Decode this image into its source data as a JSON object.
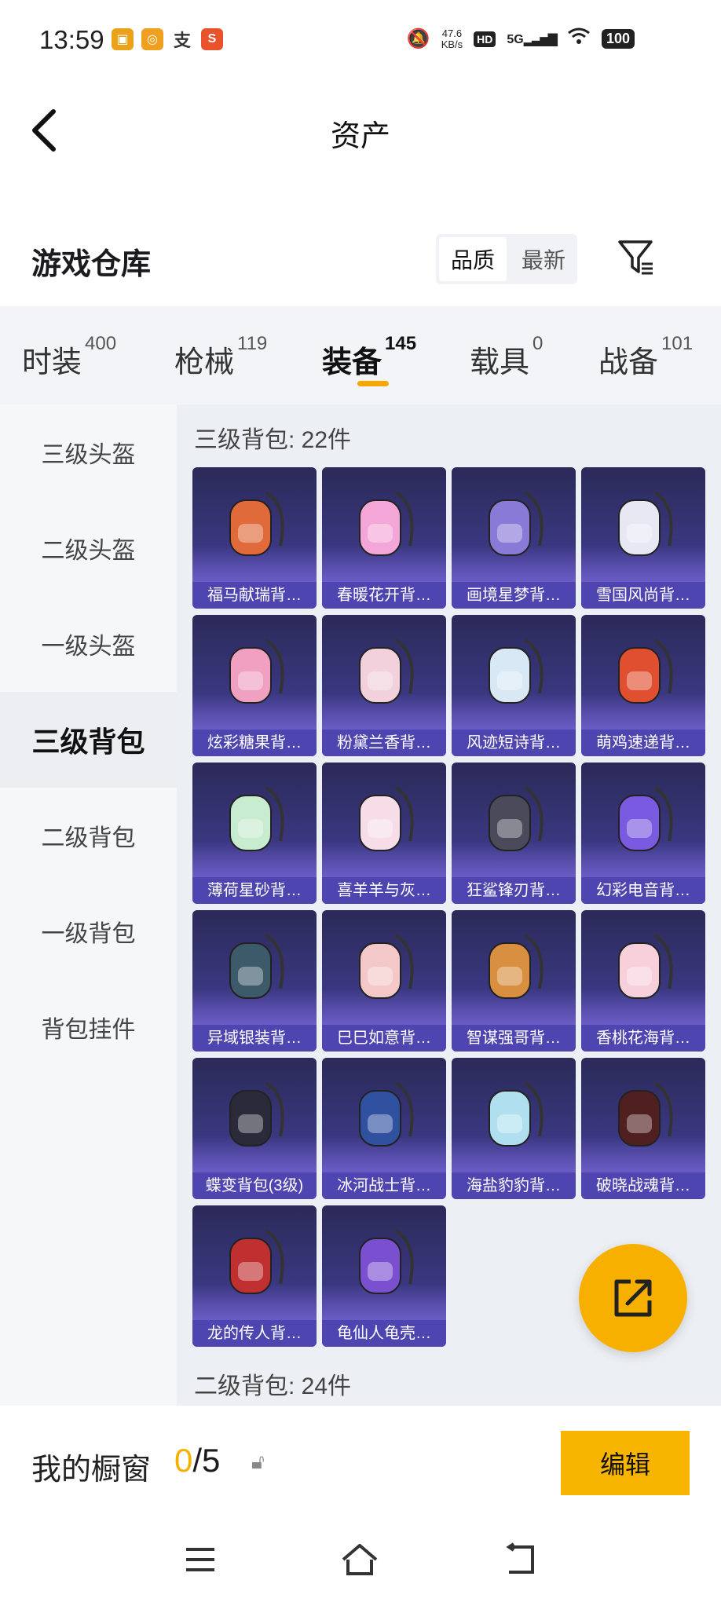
{
  "status": {
    "time": "13:59",
    "net_speed": "47.6",
    "net_unit": "KB/s",
    "hd": "HD",
    "signal": "5G",
    "battery": "100",
    "app_icons": [
      "app-icon-1",
      "app-icon-2",
      "alipay-icon",
      "app-icon-4"
    ]
  },
  "header": {
    "title": "资产"
  },
  "warehouse": {
    "title": "游戏仓库",
    "sort_options": [
      "品质",
      "最新"
    ],
    "active_sort": "品质"
  },
  "categories": [
    {
      "label": "时装",
      "count": "400"
    },
    {
      "label": "枪械",
      "count": "119"
    },
    {
      "label": "装备",
      "count": "145"
    },
    {
      "label": "载具",
      "count": "0"
    },
    {
      "label": "战备",
      "count": "101"
    }
  ],
  "sidebar": [
    {
      "label": "三级头盔"
    },
    {
      "label": "二级头盔"
    },
    {
      "label": "一级头盔"
    },
    {
      "label": "三级背包"
    },
    {
      "label": "二级背包"
    },
    {
      "label": "一级背包"
    },
    {
      "label": "背包挂件"
    }
  ],
  "section1": {
    "title": "三级背包: 22件",
    "items": [
      {
        "name": "福马献瑞背…"
      },
      {
        "name": "春暖花开背…"
      },
      {
        "name": "画境星梦背…"
      },
      {
        "name": "雪国风尚背…"
      },
      {
        "name": "炫彩糖果背…"
      },
      {
        "name": "粉黛兰香背…"
      },
      {
        "name": "风迹短诗背…"
      },
      {
        "name": "萌鸡速递背…"
      },
      {
        "name": "薄荷星砂背…"
      },
      {
        "name": "喜羊羊与灰…"
      },
      {
        "name": "狂鲨锋刃背…"
      },
      {
        "name": "幻彩电音背…"
      },
      {
        "name": "异域银装背…"
      },
      {
        "name": "巳巳如意背…"
      },
      {
        "name": "智谋强哥背…"
      },
      {
        "name": "香桃花海背…"
      },
      {
        "name": "蝶变背包(3级)"
      },
      {
        "name": "冰河战士背…"
      },
      {
        "name": "海盐豹豹背…"
      },
      {
        "name": "破晓战魂背…"
      },
      {
        "name": "龙的传人背…"
      },
      {
        "name": "龟仙人龟壳…"
      }
    ]
  },
  "section2": {
    "title": "二级背包: 24件"
  },
  "showcase": {
    "label": "我的橱窗",
    "current": "0",
    "total": "/5",
    "edit_label": "编辑"
  },
  "colors": {
    "accent": "#f7b500",
    "card_bg": "#3a3780",
    "card_label_bg": "#4e45b0"
  }
}
